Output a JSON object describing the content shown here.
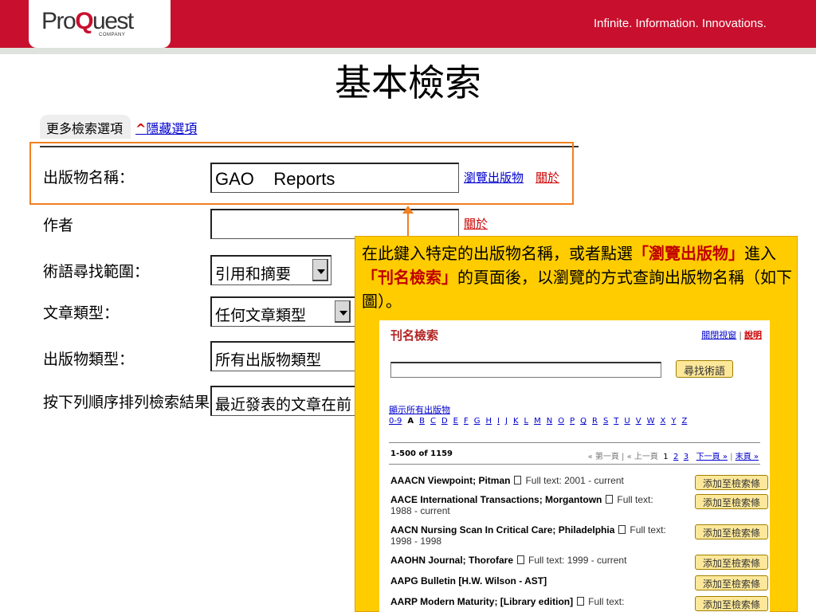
{
  "header": {
    "logo_main": "ProQuest",
    "logo_sub": "COMPANY",
    "tagline": "Infinite. Information. Innovations."
  },
  "title": "基本檢索",
  "form": {
    "more_options_tab": "更多檢索選項",
    "hide_options_caret": "^",
    "hide_options_link": "隱藏選項",
    "rows": {
      "publication_name": {
        "label": "出版物名稱：",
        "value": "GAO    Reports",
        "browse_link": "瀏覽出版物",
        "about_link": "關於"
      },
      "author": {
        "label": "作者",
        "value": "",
        "about_link": "關於"
      },
      "term_scope": {
        "label": "術語尋找範圍：",
        "selected": "引用和摘要"
      },
      "article_type": {
        "label": "文章類型：",
        "selected": "任何文章類型"
      },
      "publication_type": {
        "label": "出版物類型：",
        "selected": "所有出版物類型"
      },
      "sort_order": {
        "label": "按下列順序排列檢索結果：",
        "selected": "最近發表的文章在前"
      }
    }
  },
  "callout": {
    "text_1": "在此鍵入特定的出版物名稱，或者點選",
    "em_1": "「瀏覽出版物」",
    "text_2": "進入",
    "em_2": "「刊名檢索」",
    "text_3": "的頁面後，以瀏覽的方式查詢出版物名稱（如下圖）。"
  },
  "inner": {
    "title": "刊名檢索",
    "close_window": "關閉視窗",
    "sep": "|",
    "help": "說明",
    "find_button": "尋找術語",
    "show_all": "顯示所有出版物",
    "alphabet": [
      "0-9",
      "A",
      "B",
      "C",
      "D",
      "E",
      "F",
      "G",
      "H",
      "I",
      "J",
      "K",
      "L",
      "M",
      "N",
      "O",
      "P",
      "Q",
      "R",
      "S",
      "T",
      "U",
      "V",
      "W",
      "X",
      "Y",
      "Z"
    ],
    "range": "1-500 of 1159",
    "pager": {
      "first": "« 第一頁",
      "prev": "« 上一頁",
      "p1": "1",
      "p2": "2",
      "p3": "3",
      "next": "下一頁 »",
      "last": "末頁 »",
      "bar": "|"
    },
    "add_button": "添加至檢索條",
    "results": [
      {
        "title": "AAACN Viewpoint; Pitman",
        "fulltext": "Full text: 2001 - current"
      },
      {
        "title": "AACE International Transactions; Morgantown",
        "fulltext": "Full text: 1988 - current"
      },
      {
        "title": "AACN Nursing Scan In Critical Care; Philadelphia",
        "fulltext": "Full text: 1998 - 1998"
      },
      {
        "title": "AAOHN Journal; Thorofare",
        "fulltext": "Full text: 1999 - current"
      },
      {
        "title": "AAPG Bulletin [H.W. Wilson - AST]",
        "fulltext": ""
      },
      {
        "title": "AARP Modern Maturity; [Library edition]",
        "fulltext": "Full text:"
      }
    ]
  }
}
